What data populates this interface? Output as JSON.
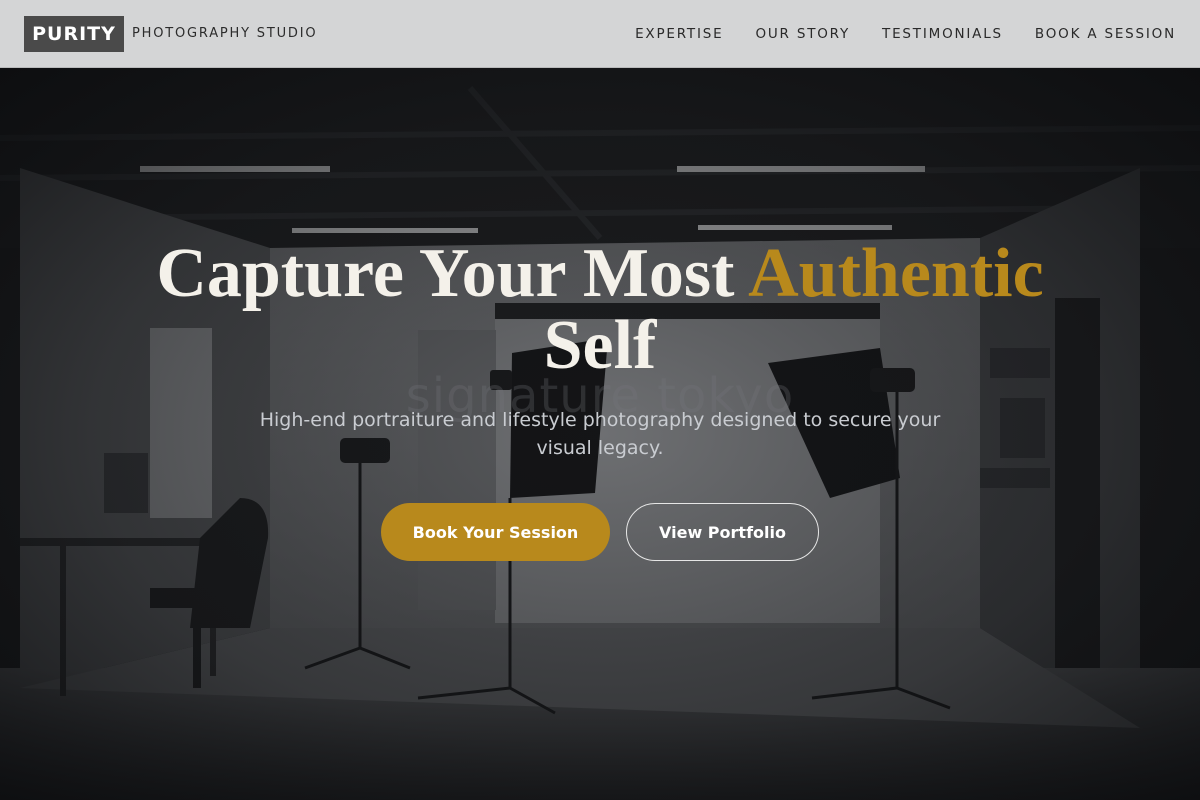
{
  "header": {
    "logo": "PURITY",
    "tagline": "PHOTOGRAPHY STUDIO",
    "nav": [
      {
        "label": "EXPERTISE"
      },
      {
        "label": "OUR STORY"
      },
      {
        "label": "TESTIMONIALS"
      },
      {
        "label": "BOOK A SESSION"
      }
    ]
  },
  "hero": {
    "headline_main": "Capture Your Most ",
    "headline_accent": "Authentic",
    "headline_end": "Self",
    "watermark": "signature tokyo",
    "subtitle": "High-end portraiture and lifestyle photography designed to secure your visual legacy.",
    "primary_button": "Book Your Session",
    "secondary_button": "View Portfolio"
  },
  "colors": {
    "accent": "#b8891c",
    "header_bg": "#d4d5d6",
    "logo_bg": "#4a4a4a"
  }
}
